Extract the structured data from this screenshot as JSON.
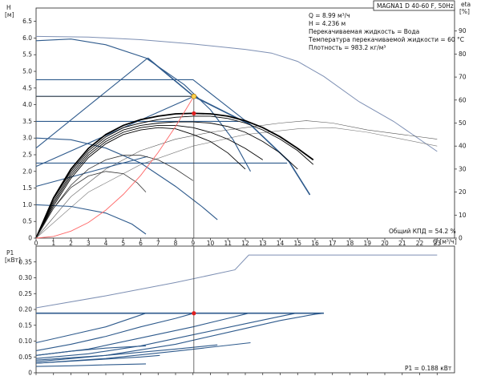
{
  "chart_data": [
    {
      "type": "line",
      "panel": "top",
      "title_box": "MAGNA1 D 40-60 F, 50Hz",
      "y_left_label": [
        "H",
        "[м]"
      ],
      "y_right_label": [
        "eta",
        "[%]"
      ],
      "x_label": "Q [м³/ч]",
      "xlim": [
        0,
        24
      ],
      "ylim_left": [
        0,
        6.9
      ],
      "ylim_right": [
        0,
        100
      ],
      "x_ticks": [
        0,
        1,
        2,
        3,
        4,
        5,
        6,
        7,
        8,
        9,
        10,
        11,
        12,
        13,
        14,
        15,
        16,
        17,
        18,
        19,
        20,
        21,
        22,
        23
      ],
      "y_ticks_left": [
        "0",
        "0.5",
        "1.0",
        "1.5",
        "2.0",
        "2.5",
        "3.0",
        "3.5",
        "4.0",
        "4.5",
        "5.0",
        "5.5",
        "6.0",
        "6.5"
      ],
      "y_ticks_right": [
        "0",
        "10",
        "20",
        "30",
        "40",
        "50",
        "60",
        "70",
        "80",
        "90"
      ],
      "info_lines": [
        "Q = 8.99 м³/ч",
        "H = 4.236 м",
        "Перекачиваемая жидкость = Вода",
        "Температура перекачиваемой жидкости = 60 °C",
        "Плотность = 983.2 кг/м³"
      ],
      "footer": "Общий КПД = 54.2 %",
      "colors": {
        "max_curve": "#7d8fb3",
        "constant_curve": "#2e5a8c",
        "efficiency": "#000000",
        "system": "#ff6666",
        "duty_point": "#ffd24d",
        "efficiency_point": "#e02020"
      },
      "max_curve": [
        [
          0,
          6.05
        ],
        [
          3,
          6.03
        ],
        [
          6,
          5.95
        ],
        [
          9,
          5.82
        ],
        [
          12,
          5.66
        ],
        [
          13.5,
          5.55
        ],
        [
          15,
          5.3
        ],
        [
          16.5,
          4.85
        ],
        [
          18.5,
          4.1
        ],
        [
          20.5,
          3.5
        ],
        [
          23,
          2.6
        ]
      ],
      "constant_pressure_lines": [
        {
          "points": [
            [
              0,
              4.75
            ],
            [
              9,
              4.75
            ],
            [
              12.3,
              3.4
            ],
            [
              14.5,
              2.3
            ],
            [
              15.7,
              1.3
            ]
          ]
        },
        {
          "points": [
            [
              0,
              4.25
            ],
            [
              9,
              4.25
            ],
            [
              12.3,
              3.4
            ],
            [
              14.5,
              2.3
            ],
            [
              15.7,
              1.3
            ]
          ]
        },
        {
          "points": [
            [
              0,
              3.5
            ],
            [
              11.6,
              3.5
            ]
          ]
        },
        {
          "points": [
            [
              0,
              2.25
            ],
            [
              14.4,
              2.25
            ]
          ]
        }
      ],
      "proportional_lines": [
        {
          "points": [
            [
              0,
              2.15
            ],
            [
              9.05,
              4.25
            ]
          ]
        },
        {
          "points": [
            [
              0,
              2.7
            ],
            [
              6.4,
              5.4
            ]
          ]
        },
        {
          "points": [
            [
              0,
              1.55
            ],
            [
              6.4,
              2.45
            ]
          ]
        }
      ],
      "pressure_diagonal": {
        "points": [
          [
            6.4,
            5.4
          ],
          [
            9.05,
            4.25
          ],
          [
            12.3,
            3.4
          ],
          [
            14.5,
            2.3
          ],
          [
            15.7,
            1.3
          ]
        ]
      },
      "autoadapt_curves": [
        {
          "points": [
            [
              0,
              5.92
            ],
            [
              2,
              5.97
            ],
            [
              4,
              5.8
            ],
            [
              6.3,
              5.4
            ],
            [
              8.5,
              4.6
            ],
            [
              10,
              3.85
            ],
            [
              11.3,
              2.95
            ],
            [
              12.3,
              2.0
            ]
          ]
        },
        {
          "points": [
            [
              0,
              3.0
            ],
            [
              2,
              2.95
            ],
            [
              4,
              2.7
            ],
            [
              6,
              2.25
            ],
            [
              8,
              1.55
            ],
            [
              9.5,
              0.95
            ],
            [
              10.4,
              0.55
            ]
          ]
        },
        {
          "points": [
            [
              0,
              1.0
            ],
            [
              2,
              0.95
            ],
            [
              4,
              0.75
            ],
            [
              5.5,
              0.42
            ],
            [
              6.3,
              0.12
            ]
          ]
        }
      ],
      "system_curve": {
        "points": [
          [
            0,
            0
          ],
          [
            1,
            0.05
          ],
          [
            2,
            0.21
          ],
          [
            3,
            0.47
          ],
          [
            4,
            0.84
          ],
          [
            5,
            1.31
          ],
          [
            6,
            1.88
          ],
          [
            7,
            2.57
          ],
          [
            8,
            3.35
          ],
          [
            9.05,
            4.25
          ]
        ]
      },
      "efficiency_curves": [
        {
          "points": [
            [
              0,
              0
            ],
            [
              1,
              14
            ],
            [
              2,
              26
            ],
            [
              3,
              35
            ],
            [
              4,
              41
            ],
            [
              5,
              45
            ],
            [
              6,
              47
            ],
            [
              7,
              48
            ],
            [
              8,
              47.5
            ],
            [
              9,
              45
            ],
            [
              10,
              42
            ],
            [
              11,
              37
            ],
            [
              12,
              30
            ]
          ]
        },
        {
          "points": [
            [
              0,
              0
            ],
            [
              1,
              15
            ],
            [
              2,
              27
            ],
            [
              3,
              36
            ],
            [
              4,
              42
            ],
            [
              5,
              46
            ],
            [
              6,
              48
            ],
            [
              7,
              49
            ],
            [
              8,
              49
            ],
            [
              9,
              48
            ],
            [
              10,
              46
            ],
            [
              11,
              43
            ],
            [
              12,
              39
            ],
            [
              13,
              34
            ]
          ]
        },
        {
          "points": [
            [
              0,
              0
            ],
            [
              1,
              16
            ],
            [
              2,
              28
            ],
            [
              3,
              37
            ],
            [
              4,
              43
            ],
            [
              5,
              47
            ],
            [
              6,
              49
            ],
            [
              7,
              50
            ],
            [
              8,
              50.5
            ],
            [
              9,
              50.5
            ],
            [
              10,
              50
            ],
            [
              11,
              48.5
            ],
            [
              12,
              46
            ],
            [
              13,
              42
            ],
            [
              14,
              37
            ],
            [
              15,
              30
            ]
          ]
        },
        {
          "points": [
            [
              0,
              0
            ],
            [
              1,
              17
            ],
            [
              2,
              29
            ],
            [
              3,
              38
            ],
            [
              4,
              44
            ],
            [
              5,
              48
            ],
            [
              6,
              50
            ],
            [
              7,
              51.5
            ],
            [
              8,
              52.5
            ],
            [
              9,
              53
            ],
            [
              10,
              53
            ],
            [
              11,
              52
            ],
            [
              12,
              50
            ],
            [
              13,
              47
            ],
            [
              14,
              43
            ],
            [
              15,
              38
            ],
            [
              15.9,
              32
            ]
          ]
        },
        {
          "points": [
            [
              0,
              0
            ],
            [
              1,
              17.5
            ],
            [
              2,
              30
            ],
            [
              3,
              39
            ],
            [
              4,
              45
            ],
            [
              5,
              49
            ],
            [
              6,
              51.5
            ],
            [
              7,
              53
            ],
            [
              8,
              54
            ],
            [
              9,
              54.2
            ],
            [
              10,
              54
            ],
            [
              11,
              53
            ],
            [
              12,
              51
            ],
            [
              13,
              48
            ],
            [
              14,
              44
            ],
            [
              15,
              39
            ],
            [
              15.9,
              34
            ]
          ]
        }
      ],
      "efficiency_curves_small": [
        {
          "points": [
            [
              0,
              0
            ],
            [
              1,
              13
            ],
            [
              2,
              22
            ],
            [
              3,
              27
            ],
            [
              4,
              29
            ],
            [
              5,
              28
            ],
            [
              5.8,
              24
            ],
            [
              6.3,
              20
            ]
          ]
        },
        {
          "points": [
            [
              0,
              0
            ],
            [
              1,
              13
            ],
            [
              2,
              23
            ],
            [
              3,
              30
            ],
            [
              4,
              34
            ],
            [
              5,
              36
            ],
            [
              6,
              36
            ],
            [
              7,
              34
            ],
            [
              8,
              30
            ],
            [
              9,
              25
            ]
          ]
        }
      ],
      "eta_max_curve": {
        "points": [
          [
            0,
            0
          ],
          [
            2,
            18
          ],
          [
            4,
            30
          ],
          [
            6,
            38
          ],
          [
            8,
            43
          ],
          [
            10,
            46
          ],
          [
            12,
            48
          ],
          [
            14,
            50
          ],
          [
            15.5,
            51
          ],
          [
            17,
            50
          ],
          [
            19,
            47
          ],
          [
            21,
            45
          ],
          [
            23,
            43
          ]
        ]
      },
      "eta_max_curve_2": {
        "points": [
          [
            0,
            0
          ],
          [
            3,
            20
          ],
          [
            6,
            32
          ],
          [
            9,
            40
          ],
          [
            12,
            45
          ],
          [
            15,
            47.5
          ],
          [
            17,
            48
          ],
          [
            19,
            46
          ],
          [
            21,
            43
          ],
          [
            23,
            40
          ]
        ]
      },
      "duty_point": [
        9.05,
        4.25
      ],
      "efficiency_point": {
        "q": 9.05,
        "eta": 54.2
      }
    },
    {
      "type": "line",
      "panel": "bottom",
      "y_label": [
        "P1",
        "[кВт]"
      ],
      "xlim": [
        0,
        24
      ],
      "ylim": [
        0,
        0.4
      ],
      "y_ticks": [
        "0",
        "0.05",
        "0.10",
        "0.15",
        "0.20",
        "0.25",
        "0.30",
        "0.35"
      ],
      "footer": "P1 = 0.188 кВт",
      "max_curve": [
        [
          0,
          0.205
        ],
        [
          4,
          0.243
        ],
        [
          8,
          0.285
        ],
        [
          11.4,
          0.325
        ],
        [
          12.2,
          0.372
        ],
        [
          16,
          0.372
        ],
        [
          23,
          0.372
        ]
      ],
      "curves": [
        {
          "points": [
            [
              0,
              0.095
            ],
            [
              2,
              0.12
            ],
            [
              4,
              0.145
            ],
            [
              6.3,
              0.188
            ]
          ]
        },
        {
          "points": [
            [
              0,
              0.07
            ],
            [
              2,
              0.09
            ],
            [
              4,
              0.115
            ],
            [
              6,
              0.145
            ],
            [
              8,
              0.172
            ],
            [
              9.05,
              0.188
            ]
          ]
        },
        {
          "points": [
            [
              0,
              0.055
            ],
            [
              3,
              0.075
            ],
            [
              6,
              0.11
            ],
            [
              9,
              0.145
            ],
            [
              11,
              0.172
            ],
            [
              12.2,
              0.188
            ]
          ]
        },
        {
          "points": [
            [
              0,
              0.045
            ],
            [
              3,
              0.06
            ],
            [
              6,
              0.085
            ],
            [
              9,
              0.12
            ],
            [
              12,
              0.155
            ],
            [
              14,
              0.178
            ],
            [
              14.9,
              0.188
            ]
          ]
        },
        {
          "points": [
            [
              0,
              0.035
            ],
            [
              4,
              0.055
            ],
            [
              8,
              0.09
            ],
            [
              12,
              0.14
            ],
            [
              14,
              0.165
            ],
            [
              16,
              0.185
            ],
            [
              16.5,
              0.188
            ]
          ]
        },
        {
          "points": [
            [
              0,
              0.055
            ],
            [
              2,
              0.068
            ],
            [
              4,
              0.078
            ],
            [
              6.3,
              0.085
            ]
          ]
        },
        {
          "points": [
            [
              0,
              0.04
            ],
            [
              4,
              0.055
            ],
            [
              8,
              0.075
            ],
            [
              10.4,
              0.088
            ]
          ]
        },
        {
          "points": [
            [
              0,
              0.03
            ],
            [
              4,
              0.045
            ],
            [
              8,
              0.068
            ],
            [
              12.3,
              0.095
            ]
          ]
        },
        {
          "points": [
            [
              0,
              0.02
            ],
            [
              2,
              0.022
            ],
            [
              4,
              0.025
            ],
            [
              6.3,
              0.028
            ]
          ]
        },
        {
          "points": [
            [
              0,
              0.03
            ],
            [
              3,
              0.04
            ],
            [
              6,
              0.05
            ],
            [
              7.1,
              0.055
            ]
          ]
        }
      ],
      "flat_line": [
        [
          0,
          0.188
        ],
        [
          16.5,
          0.188
        ]
      ],
      "operating_point": {
        "q": 9.05,
        "p": 0.188
      }
    }
  ]
}
